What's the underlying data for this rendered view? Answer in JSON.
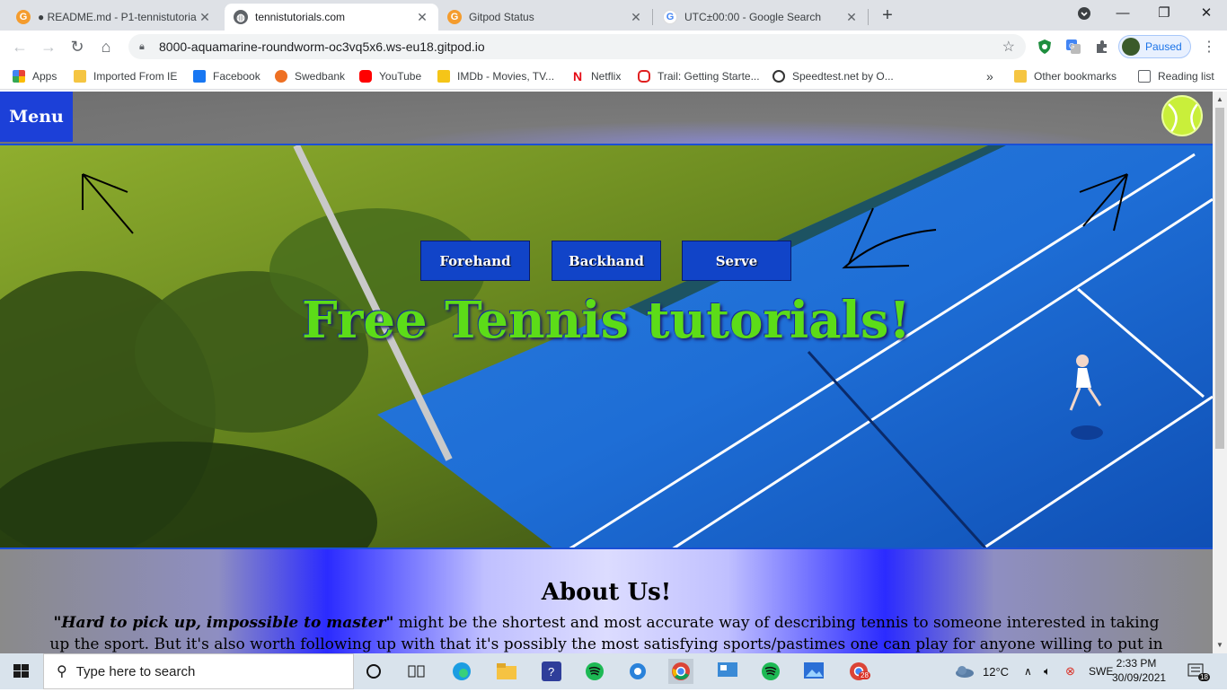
{
  "browser": {
    "tabs": [
      {
        "title": "● README.md - P1-tennistutoria",
        "icon": "gitpod-icon",
        "active": false
      },
      {
        "title": "tennistutorials.com",
        "icon": "globe-icon",
        "active": true
      },
      {
        "title": "Gitpod Status",
        "icon": "gitpod-icon",
        "active": false
      },
      {
        "title": "UTC±00:00 - Google Search",
        "icon": "google-icon",
        "active": false
      }
    ],
    "new_tab_symbol": "+",
    "url": "8000-aquamarine-roundworm-oc3vq5x6.ws-eu18.gitpod.io",
    "profile_label": "Paused",
    "bookmarks": [
      {
        "label": "Apps"
      },
      {
        "label": "Imported From IE"
      },
      {
        "label": "Facebook"
      },
      {
        "label": "Swedbank"
      },
      {
        "label": "YouTube"
      },
      {
        "label": "IMDb - Movies, TV..."
      },
      {
        "label": "Netflix"
      },
      {
        "label": "Trail: Getting Starte..."
      },
      {
        "label": "Speedtest.net by O..."
      }
    ],
    "bookmarks_overflow": "»",
    "other_bookmarks": "Other bookmarks",
    "reading_list": "Reading list"
  },
  "site": {
    "menu_label": "Menu",
    "nav_buttons": [
      "Forehand",
      "Backhand",
      "Serve"
    ],
    "hero_title": "Free Tennis tutorials!",
    "about_heading": "About Us!",
    "about_quote": "\"Hard to pick up, impossible to master\"",
    "about_text": " might be the shortest and most accurate way of describing tennis to someone interested in taking up the sport. But it's also worth following up with that it's possibly the most satisfying sports/pastimes one can play for anyone willing to put in the"
  },
  "taskbar": {
    "search_placeholder": "Type here to search",
    "weather": "12°C",
    "language": "SWE",
    "time": "2:33 PM",
    "date": "30/09/2021",
    "chrome_badge": "28",
    "notification_count": "18"
  },
  "colors": {
    "menu_bg": "#1c40d8",
    "hero_title": "#5cdc18",
    "nav_button_bg": "#1144c8"
  }
}
